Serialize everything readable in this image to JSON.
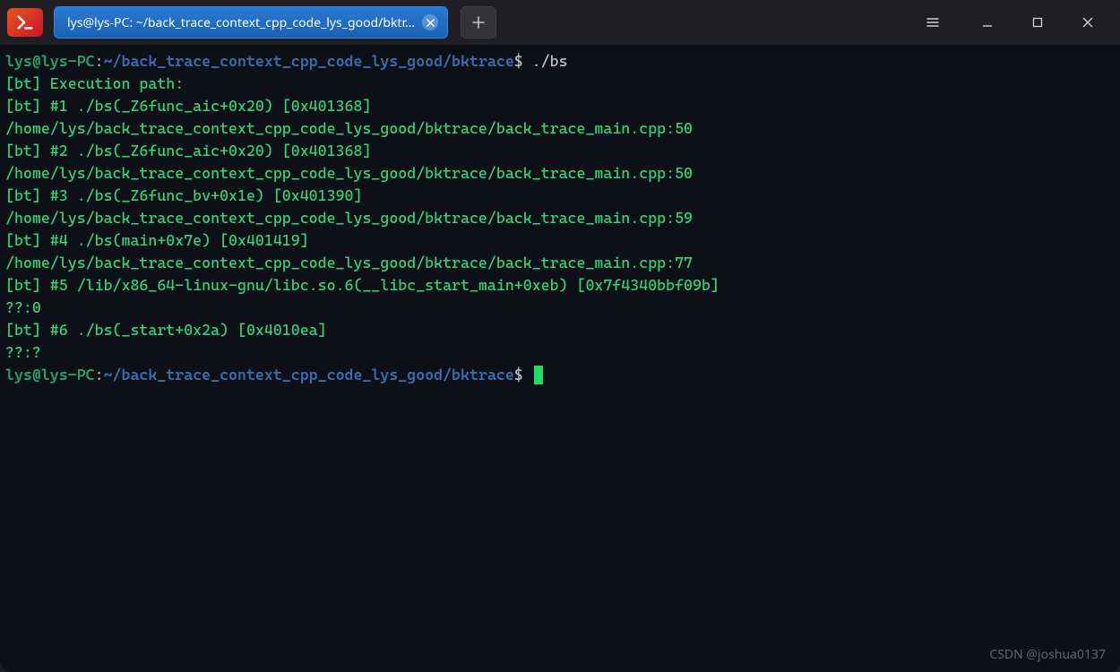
{
  "tab": {
    "title": "lys@lys-PC: ~/back_trace_context_cpp_code_lys_good/bktr…"
  },
  "prompt": {
    "user_host": "lys@lys-PC",
    "colon": ":",
    "path": "~/back_trace_context_cpp_code_lys_good/bktrace",
    "dollar": "$",
    "command": " ./bs"
  },
  "output": [
    "[bt] Execution path:",
    "[bt] #1 ./bs(_Z6func_aic+0x20) [0x401368]",
    "/home/lys/back_trace_context_cpp_code_lys_good/bktrace/back_trace_main.cpp:50",
    "[bt] #2 ./bs(_Z6func_aic+0x20) [0x401368]",
    "/home/lys/back_trace_context_cpp_code_lys_good/bktrace/back_trace_main.cpp:50",
    "[bt] #3 ./bs(_Z6func_bv+0x1e) [0x401390]",
    "/home/lys/back_trace_context_cpp_code_lys_good/bktrace/back_trace_main.cpp:59",
    "[bt] #4 ./bs(main+0x7e) [0x401419]",
    "/home/lys/back_trace_context_cpp_code_lys_good/bktrace/back_trace_main.cpp:77",
    "[bt] #5 /lib/x86_64-linux-gnu/libc.so.6(__libc_start_main+0xeb) [0x7f4340bbf09b]",
    "??:0",
    "[bt] #6 ./bs(_start+0x2a) [0x4010ea]",
    "??:?"
  ],
  "watermark": "CSDN @joshua0137"
}
